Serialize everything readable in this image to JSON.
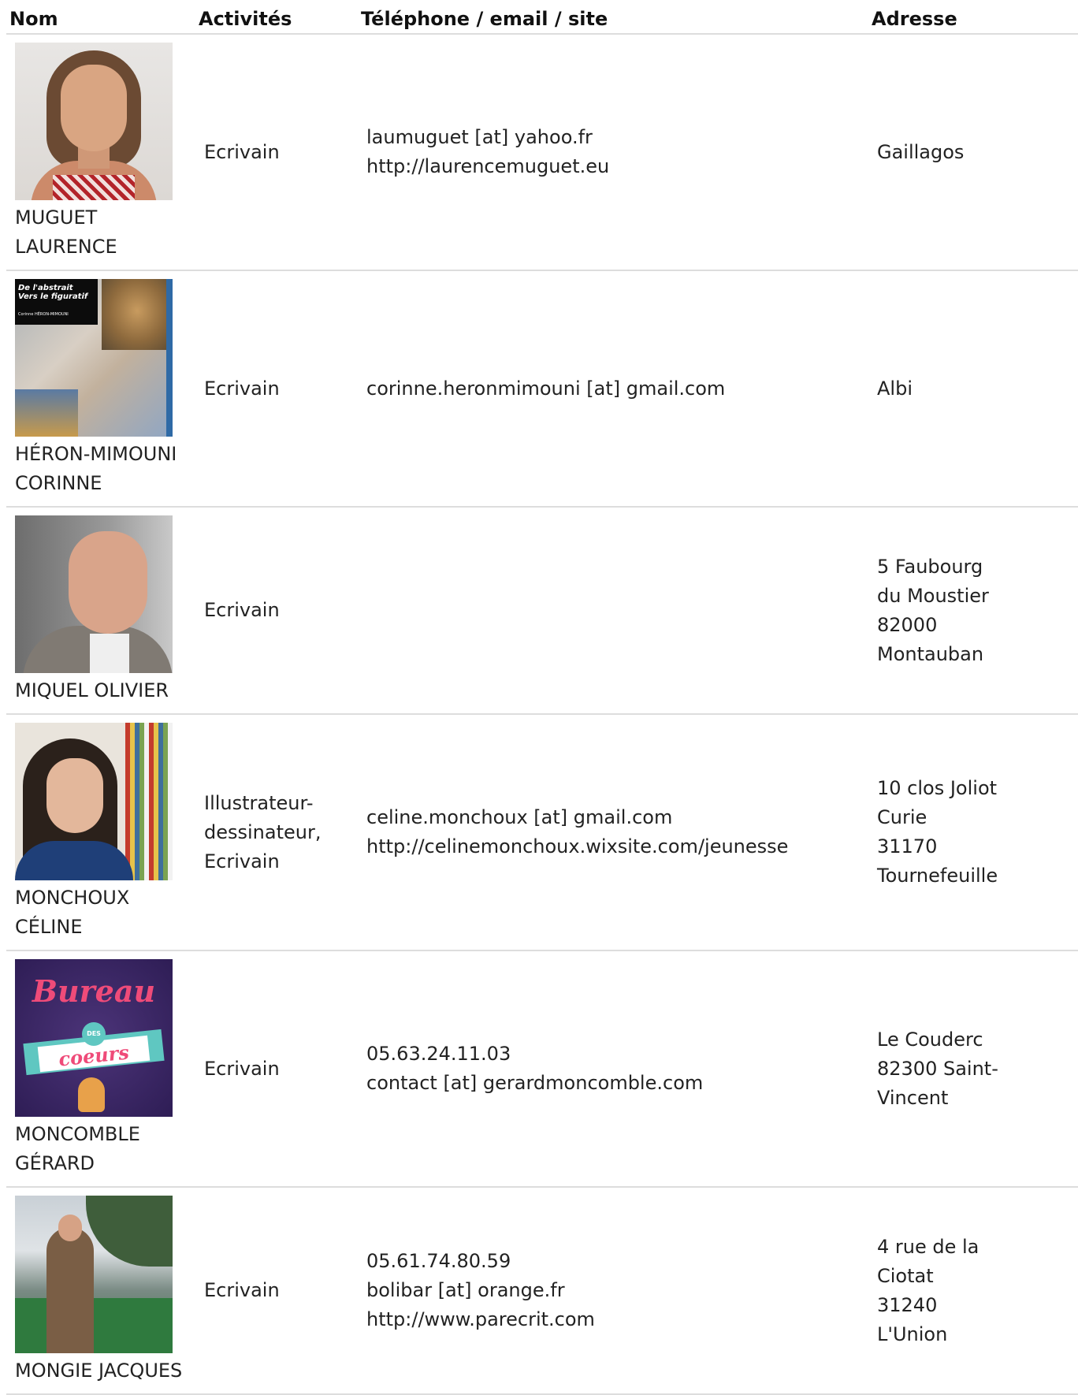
{
  "headers": {
    "nom": "Nom",
    "activites": "Activités",
    "contact": "Téléphone / email / site",
    "adresse": "Adresse"
  },
  "rows": [
    {
      "name_lines": [
        "MUGUET",
        "LAURENCE"
      ],
      "activity_lines": [
        "Ecrivain"
      ],
      "contact_lines": [
        "laumuguet [at] yahoo.fr",
        "http://laurencemuguet.eu"
      ],
      "address_lines": [
        "Gaillagos"
      ]
    },
    {
      "name_lines": [
        "HÉRON-MIMOUNI",
        "CORINNE"
      ],
      "cover_title": "De l'abstrait\nVers le figuratif",
      "cover_author": "Corinne HÉRON-MIMOUNI",
      "activity_lines": [
        "Ecrivain"
      ],
      "contact_lines": [
        "corinne.heronmimouni [at] gmail.com"
      ],
      "address_lines": [
        "Albi"
      ]
    },
    {
      "name_lines": [
        "MIQUEL OLIVIER"
      ],
      "activity_lines": [
        "Ecrivain"
      ],
      "contact_lines": [],
      "address_lines": [
        "5 Faubourg",
        "du Moustier",
        "82000",
        "Montauban"
      ]
    },
    {
      "name_lines": [
        "MONCHOUX CÉLINE"
      ],
      "activity_lines": [
        "Illustrateur-",
        "dessinateur,",
        "Ecrivain"
      ],
      "contact_lines": [
        "celine.monchoux [at] gmail.com",
        "http://celinemonchoux.wixsite.com/jeunesse"
      ],
      "address_lines": [
        "10 clos Joliot",
        "Curie",
        "31170",
        "Tournefeuille"
      ]
    },
    {
      "name_lines": [
        "MONCOMBLE",
        "GÉRARD"
      ],
      "cover_title": "Bureau",
      "cover_badge": "DES",
      "cover_subtitle": "coeurs",
      "activity_lines": [
        "Ecrivain"
      ],
      "contact_lines": [
        "05.63.24.11.03",
        "contact [at] gerardmoncomble.com"
      ],
      "address_lines": [
        "Le Couderc",
        "82300 Saint-",
        "Vincent"
      ]
    },
    {
      "name_lines": [
        "MONGIE JACQUES"
      ],
      "activity_lines": [
        "Ecrivain"
      ],
      "contact_lines": [
        "05.61.74.80.59",
        "bolibar [at] orange.fr",
        "http://www.parecrit.com"
      ],
      "address_lines": [
        "4 rue de la",
        "Ciotat",
        "31240",
        "L'Union"
      ]
    }
  ]
}
